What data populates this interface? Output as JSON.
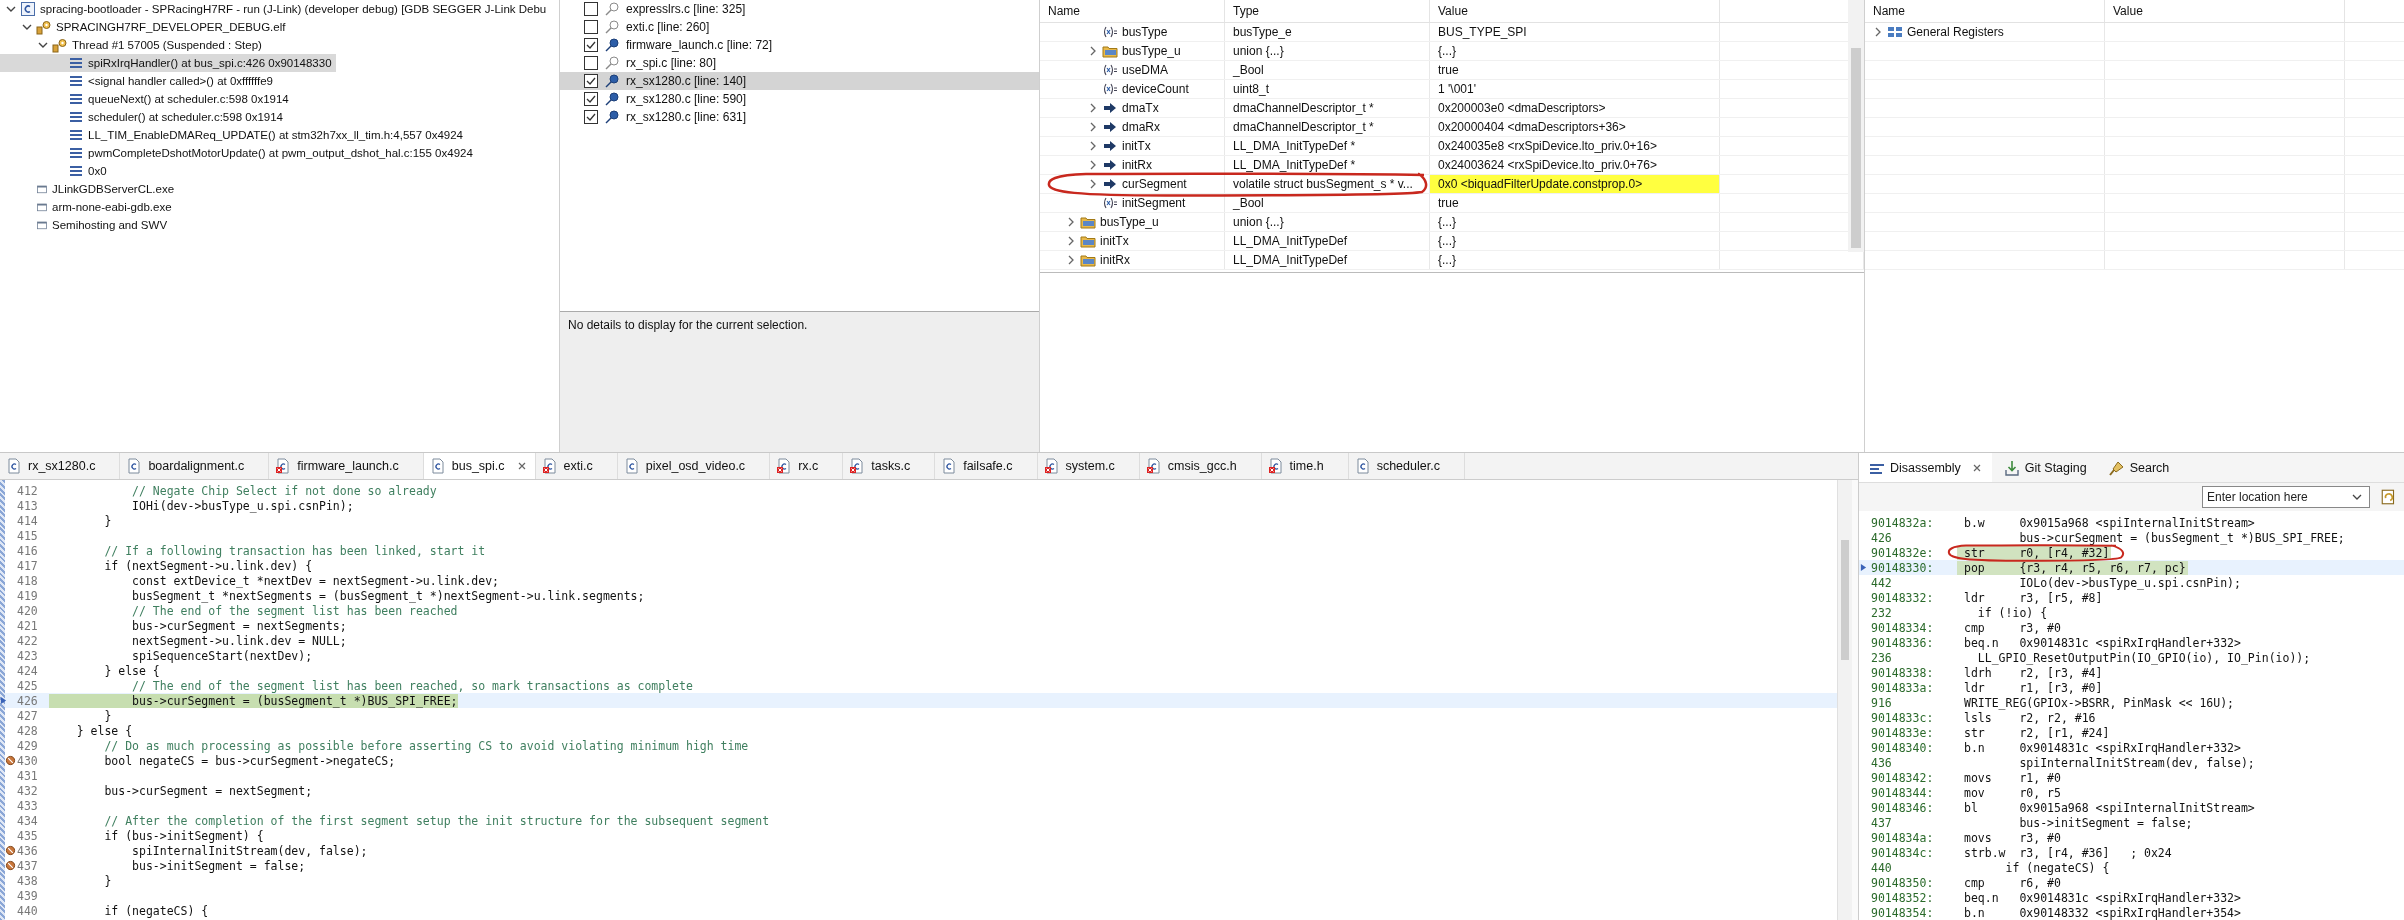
{
  "debug": {
    "items": [
      {
        "label": "spracing-bootloader - SPRacingH7RF - run (J-Link) (developer debug) [GDB SEGGER J-Link Debu",
        "kind": "launch",
        "expanded": true,
        "children": [
          {
            "label": "SPRACINGH7RF_DEVELOPER_DEBUG.elf",
            "kind": "elf",
            "expanded": true,
            "children": [
              {
                "label": "Thread #1 57005 (Suspended : Step)",
                "kind": "thread",
                "expanded": true,
                "children": [
                  {
                    "label": "spiRxIrqHandler() at bus_spi.c:426 0x90148330",
                    "kind": "frame",
                    "selected": true
                  },
                  {
                    "label": "<signal handler called>() at 0xffffffe9",
                    "kind": "frame",
                    "selected": false
                  },
                  {
                    "label": "queueNext() at scheduler.c:598 0x1914",
                    "kind": "frame",
                    "selected": false
                  },
                  {
                    "label": "scheduler() at scheduler.c:598 0x1914",
                    "kind": "frame",
                    "selected": false
                  },
                  {
                    "label": "LL_TIM_EnableDMAReq_UPDATE() at stm32h7xx_ll_tim.h:4,557 0x4924",
                    "kind": "frame",
                    "selected": false
                  },
                  {
                    "label": "pwmCompleteDshotMotorUpdate() at pwm_output_dshot_hal.c:155 0x4924",
                    "kind": "frame",
                    "selected": false
                  },
                  {
                    "label": "0x0",
                    "kind": "frame",
                    "selected": false
                  }
                ]
              }
            ]
          },
          {
            "label": "JLinkGDBServerCL.exe",
            "kind": "process"
          },
          {
            "label": "arm-none-eabi-gdb.exe",
            "kind": "process"
          },
          {
            "label": "Semihosting and SWV",
            "kind": "process"
          }
        ]
      }
    ]
  },
  "breakpoints": {
    "items": [
      {
        "label": "expresslrs.c [line: 325]",
        "checked": false,
        "selected": false
      },
      {
        "label": "exti.c [line: 260]",
        "checked": false,
        "selected": false
      },
      {
        "label": "firmware_launch.c [line: 72]",
        "checked": true,
        "selected": false
      },
      {
        "label": "rx_spi.c [line: 80]",
        "checked": false,
        "selected": false
      },
      {
        "label": "rx_sx1280.c [line: 140]",
        "checked": true,
        "selected": true
      },
      {
        "label": "rx_sx1280.c [line: 590]",
        "checked": true,
        "selected": false
      },
      {
        "label": "rx_sx1280.c [line: 631]",
        "checked": true,
        "selected": false
      }
    ],
    "details": "No details to display for the current selection."
  },
  "variables": {
    "columns": [
      "Name",
      "Type",
      "Value"
    ],
    "member_rows": [
      {
        "name": "busType",
        "type": "busType_e",
        "value": "BUS_TYPE_SPI",
        "kind": "field",
        "changed": false
      },
      {
        "name": "busType_u",
        "type": "union {...}",
        "value": "{...}",
        "kind": "struct",
        "changed": false
      },
      {
        "name": "useDMA",
        "type": "_Bool",
        "value": "true",
        "kind": "field",
        "changed": false
      },
      {
        "name": "deviceCount",
        "type": "uint8_t",
        "value": "1 '\\001'",
        "kind": "field",
        "changed": false
      },
      {
        "name": "dmaTx",
        "type": "dmaChannelDescriptor_t *",
        "value": "0x200003e0 <dmaDescriptors>",
        "kind": "pointer",
        "changed": false
      },
      {
        "name": "dmaRx",
        "type": "dmaChannelDescriptor_t *",
        "value": "0x20000404 <dmaDescriptors+36>",
        "kind": "pointer",
        "changed": false
      },
      {
        "name": "initTx",
        "type": "LL_DMA_InitTypeDef *",
        "value": "0x240035e8 <rxSpiDevice.lto_priv.0+16>",
        "kind": "pointer",
        "changed": false
      },
      {
        "name": "initRx",
        "type": "LL_DMA_InitTypeDef *",
        "value": "0x24003624 <rxSpiDevice.lto_priv.0+76>",
        "kind": "pointer",
        "changed": false
      },
      {
        "name": "curSegment",
        "type": "volatile struct busSegment_s * v...",
        "value": "0x0 <biquadFilterUpdate.constprop.0>",
        "kind": "pointer",
        "changed": true
      },
      {
        "name": "initSegment",
        "type": "_Bool",
        "value": "true",
        "kind": "field",
        "changed": false
      }
    ],
    "rows": [
      {
        "name": "busType_u",
        "type": "union {...}",
        "value": "{...}",
        "kind": "struct",
        "changed": false
      },
      {
        "name": "initTx",
        "type": "LL_DMA_InitTypeDef",
        "value": "{...}",
        "kind": "struct",
        "changed": false
      },
      {
        "name": "initRx",
        "type": "LL_DMA_InitTypeDef",
        "value": "{...}",
        "kind": "struct",
        "changed": false
      }
    ]
  },
  "registers": {
    "columns": [
      "Name",
      "Value"
    ],
    "rows": [
      {
        "name": "General Registers"
      }
    ]
  },
  "editor": {
    "tabs": [
      {
        "label": "rx_sx1280.c",
        "selected": false,
        "error": false
      },
      {
        "label": "boardalignment.c",
        "selected": false,
        "error": false
      },
      {
        "label": "firmware_launch.c",
        "selected": false,
        "error": true
      },
      {
        "label": "bus_spi.c",
        "selected": true,
        "error": false
      },
      {
        "label": "exti.c",
        "selected": false,
        "error": true
      },
      {
        "label": "pixel_osd_video.c",
        "selected": false,
        "error": false
      },
      {
        "label": "rx.c",
        "selected": false,
        "error": true
      },
      {
        "label": "tasks.c",
        "selected": false,
        "error": true
      },
      {
        "label": "failsafe.c",
        "selected": false,
        "error": false
      },
      {
        "label": "system.c",
        "selected": false,
        "error": true
      },
      {
        "label": "cmsis_gcc.h",
        "selected": false,
        "error": true
      },
      {
        "label": "time.h",
        "selected": false,
        "error": true
      },
      {
        "label": "scheduler.c",
        "selected": false,
        "error": false
      }
    ],
    "lines": [
      {
        "num": "412",
        "text": "            // Negate Chip Select if not done so already",
        "kind": "comment",
        "current": false,
        "breakpoint": false
      },
      {
        "num": "413",
        "text": "            IOHi(dev->busType_u.spi.csnPin);",
        "kind": "code",
        "current": false,
        "breakpoint": false
      },
      {
        "num": "414",
        "text": "        }",
        "kind": "code",
        "current": false,
        "breakpoint": false
      },
      {
        "num": "415",
        "current": false,
        "breakpoint": false
      },
      {
        "num": "416",
        "text": "        // If a following transaction has been linked, start it",
        "kind": "comment",
        "current": false,
        "breakpoint": false
      },
      {
        "num": "417",
        "text": "        if (nextSegment->u.link.dev) {",
        "kind": "code",
        "current": false,
        "breakpoint": false
      },
      {
        "num": "418",
        "text": "            const extDevice_t *nextDev = nextSegment->u.link.dev;",
        "kind": "code",
        "current": false,
        "breakpoint": false
      },
      {
        "num": "419",
        "text": "            busSegment_t *nextSegments = (busSegment_t *)nextSegment->u.link.segments;",
        "kind": "code",
        "current": false,
        "breakpoint": false
      },
      {
        "num": "420",
        "text": "            // The end of the segment list has been reached",
        "kind": "comment",
        "current": false,
        "breakpoint": false
      },
      {
        "num": "421",
        "text": "            bus->curSegment = nextSegments;",
        "kind": "code",
        "current": false,
        "breakpoint": false
      },
      {
        "num": "422",
        "text": "            nextSegment->u.link.dev = NULL;",
        "kind": "code",
        "current": false,
        "breakpoint": false
      },
      {
        "num": "423",
        "text": "            spiSequenceStart(nextDev);",
        "kind": "code",
        "current": false,
        "breakpoint": false
      },
      {
        "num": "424",
        "text": "        } else {",
        "kind": "code",
        "current": false,
        "breakpoint": false
      },
      {
        "num": "425",
        "text": "            // The end of the segment list has been reached, so mark transactions as complete",
        "kind": "comment",
        "current": false,
        "breakpoint": false
      },
      {
        "num": "426",
        "text": "            bus->curSegment = (busSegment_t *)BUS_SPI_FREE;",
        "kind": "code",
        "current": true,
        "breakpoint": false
      },
      {
        "num": "427",
        "text": "        }",
        "kind": "code",
        "current": false,
        "breakpoint": false
      },
      {
        "num": "428",
        "text": "    } else {",
        "kind": "code",
        "current": false,
        "breakpoint": false
      },
      {
        "num": "429",
        "text": "        // Do as much processing as possible before asserting CS to avoid violating minimum high time",
        "kind": "comment",
        "current": false,
        "breakpoint": false
      },
      {
        "num": "430",
        "text": "        bool negateCS = bus->curSegment->negateCS;",
        "kind": "code",
        "current": false,
        "breakpoint": true
      },
      {
        "num": "431",
        "current": false,
        "breakpoint": false
      },
      {
        "num": "432",
        "text": "        bus->curSegment = nextSegment;",
        "kind": "code",
        "current": false,
        "breakpoint": false
      },
      {
        "num": "433",
        "current": false,
        "breakpoint": false
      },
      {
        "num": "434",
        "text": "        // After the completion of the first segment setup the init structure for the subsequent segment",
        "kind": "comment",
        "current": false,
        "breakpoint": false
      },
      {
        "num": "435",
        "text": "        if (bus->initSegment) {",
        "kind": "code",
        "current": false,
        "breakpoint": false
      },
      {
        "num": "436",
        "text": "            spiInternalInitStream(dev, false);",
        "kind": "code",
        "current": false,
        "breakpoint": true
      },
      {
        "num": "437",
        "text": "            bus->initSegment = false;",
        "kind": "code",
        "current": false,
        "breakpoint": true
      },
      {
        "num": "438",
        "text": "        }",
        "kind": "code",
        "current": false,
        "breakpoint": false
      },
      {
        "num": "439",
        "current": false,
        "breakpoint": false
      },
      {
        "num": "440",
        "text": "        if (negateCS) {",
        "kind": "code",
        "current": false,
        "breakpoint": false
      }
    ]
  },
  "disassembly": {
    "tabs": [
      {
        "label": "Disassembly",
        "selected": true,
        "kind": "disassembly"
      },
      {
        "label": "Git Staging",
        "selected": false,
        "kind": "git"
      },
      {
        "label": "Search",
        "selected": false,
        "kind": "search"
      }
    ],
    "location_placeholder": "Enter location here",
    "rows": [
      {
        "kind": "asm",
        "addr": "9014832a:",
        "op": "b.w",
        "args": "0x9015a968 <spiInternalInitStream>",
        "highlighted": false,
        "current": false
      },
      {
        "kind": "src",
        "addr": "426",
        "text": "        bus->curSegment = (busSegment_t *)BUS_SPI_FREE;",
        "highlighted": false,
        "current": false
      },
      {
        "kind": "asm",
        "addr": "9014832e:",
        "op": "str",
        "args": "r0, [r4, #32]",
        "highlighted": true,
        "current": false
      },
      {
        "kind": "asm",
        "addr": "90148330:",
        "op": "pop",
        "args": "{r3, r4, r5, r6, r7, pc}",
        "highlighted": true,
        "current": true
      },
      {
        "kind": "src",
        "addr": "442",
        "text": "        IOLo(dev->busType_u.spi.csnPin);",
        "highlighted": false,
        "current": false
      },
      {
        "kind": "asm",
        "addr": "90148332:",
        "op": "ldr",
        "args": "r3, [r5, #8]",
        "highlighted": false,
        "current": false
      },
      {
        "kind": "src",
        "addr": "232",
        "text": "  if (!io) {",
        "highlighted": false,
        "current": false
      },
      {
        "kind": "asm",
        "addr": "90148334:",
        "op": "cmp",
        "args": "r3, #0",
        "highlighted": false,
        "current": false
      },
      {
        "kind": "asm",
        "addr": "90148336:",
        "op": "beq.n",
        "args": "0x9014831c <spiRxIrqHandler+332>",
        "highlighted": false,
        "current": false
      },
      {
        "kind": "src",
        "addr": "236",
        "text": "  LL_GPIO_ResetOutputPin(IO_GPIO(io), IO_Pin(io));",
        "highlighted": false,
        "current": false
      },
      {
        "kind": "asm",
        "addr": "90148338:",
        "op": "ldrh",
        "args": "r2, [r3, #4]",
        "highlighted": false,
        "current": false
      },
      {
        "kind": "asm",
        "addr": "9014833a:",
        "op": "ldr",
        "args": "r1, [r3, #0]",
        "highlighted": false,
        "current": false
      },
      {
        "kind": "src",
        "addr": "916",
        "text": "WRITE_REG(GPIOx->BSRR, PinMask << 16U);",
        "highlighted": false,
        "current": false
      },
      {
        "kind": "asm",
        "addr": "9014833c:",
        "op": "lsls",
        "args": "r2, r2, #16",
        "highlighted": false,
        "current": false
      },
      {
        "kind": "asm",
        "addr": "9014833e:",
        "op": "str",
        "args": "r2, [r1, #24]",
        "highlighted": false,
        "current": false
      },
      {
        "kind": "asm",
        "addr": "90148340:",
        "op": "b.n",
        "args": "0x9014831c <spiRxIrqHandler+332>",
        "highlighted": false,
        "current": false
      },
      {
        "kind": "src",
        "addr": "436",
        "text": "        spiInternalInitStream(dev, false);",
        "highlighted": false,
        "current": false
      },
      {
        "kind": "asm",
        "addr": "90148342:",
        "op": "movs",
        "args": "r1, #0",
        "highlighted": false,
        "current": false
      },
      {
        "kind": "asm",
        "addr": "90148344:",
        "op": "mov",
        "args": "r0, r5",
        "highlighted": false,
        "current": false
      },
      {
        "kind": "asm",
        "addr": "90148346:",
        "op": "bl",
        "args": "0x9015a968 <spiInternalInitStream>",
        "highlighted": false,
        "current": false
      },
      {
        "kind": "src",
        "addr": "437",
        "text": "        bus->initSegment = false;",
        "highlighted": false,
        "current": false
      },
      {
        "kind": "asm",
        "addr": "9014834a:",
        "op": "movs",
        "args": "r3, #0",
        "highlighted": false,
        "current": false
      },
      {
        "kind": "asm",
        "addr": "9014834c:",
        "op": "strb.w",
        "args": "r3, [r4, #36]   ; 0x24",
        "highlighted": false,
        "current": false
      },
      {
        "kind": "src",
        "addr": "440",
        "text": "      if (negateCS) {",
        "highlighted": false,
        "current": false
      },
      {
        "kind": "asm",
        "addr": "90148350:",
        "op": "cmp",
        "args": "r6, #0",
        "highlighted": false,
        "current": false
      },
      {
        "kind": "asm",
        "addr": "90148352:",
        "op": "beq.n",
        "args": "0x9014831c <spiRxIrqHandler+332>",
        "highlighted": false,
        "current": false
      },
      {
        "kind": "asm",
        "addr": "90148354:",
        "op": "b.n",
        "args": "0x90148332 <spiRxIrqHandler+354>",
        "highlighted": false,
        "current": false
      }
    ]
  }
}
